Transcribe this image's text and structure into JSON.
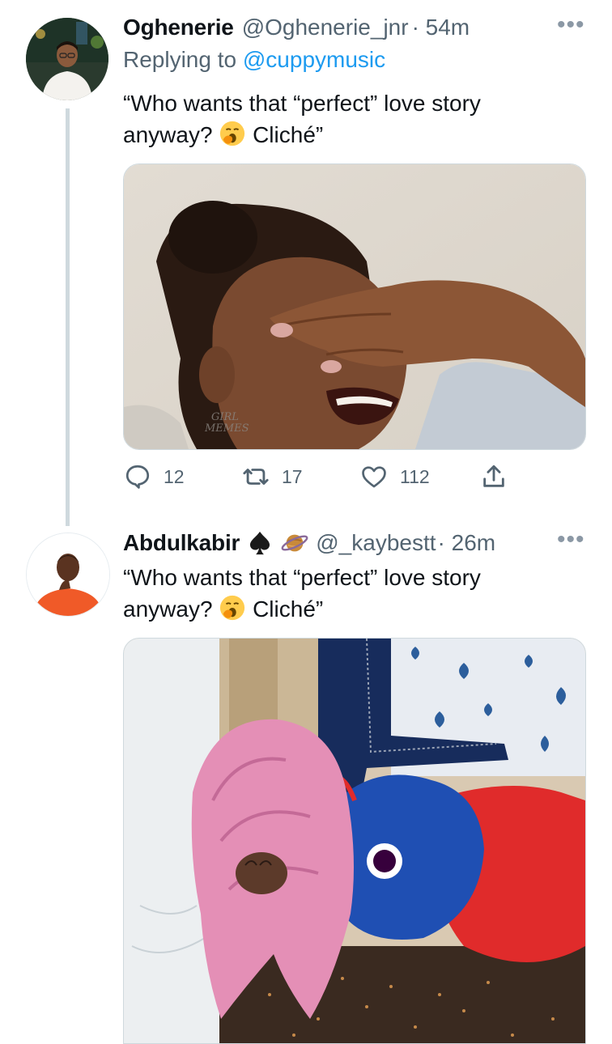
{
  "tweet1": {
    "display_name": "Oghenerie",
    "handle": "@Oghenerie_jnr",
    "time": "· 54m",
    "replying_prefix": "Replying to",
    "replying_to": "@cuppymusic",
    "line1": "“Who wants that “perfect” love story",
    "line2_a": "anyway?",
    "line2_b": "Cliché”",
    "image_watermark": "GIRL MEMES",
    "actions": {
      "reply_count": "12",
      "retweet_count": "17",
      "like_count": "112"
    }
  },
  "tweet2": {
    "display_name": "Abdulkabir",
    "handle": "@_kaybestt",
    "time": "· 26m",
    "line1": "“Who wants that “perfect” love story",
    "line2_a": "anyway?",
    "line2_b": "Cliché”"
  },
  "icons": [
    "more-icon",
    "reply-icon",
    "retweet-icon",
    "like-icon",
    "share-icon",
    "spade-icon",
    "planet-icon",
    "yawning-face-icon"
  ],
  "colors": {
    "link": "#1d9bf0",
    "muted": "#536471",
    "text": "#0f1419",
    "thread_line": "#cfd9de"
  }
}
